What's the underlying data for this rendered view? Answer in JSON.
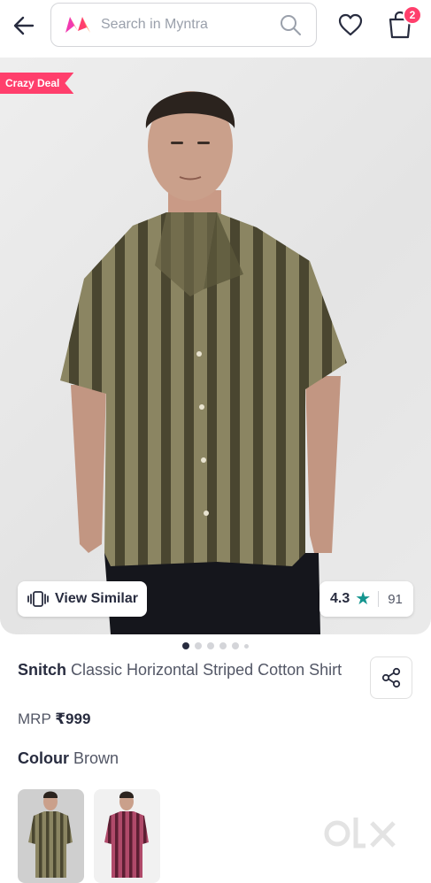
{
  "header": {
    "search_placeholder": "Search in Myntra",
    "bag_count": "2"
  },
  "product": {
    "deal_badge": "Crazy Deal",
    "view_similar_label": "View Similar",
    "rating": "4.3",
    "rating_count": "91",
    "brand": "Snitch",
    "name": "Classic Horizontal Striped Cotton Shirt",
    "mrp_label": "MRP",
    "price": "₹999",
    "colour_label": "Colour",
    "colour_value": "Brown"
  },
  "carousel": {
    "active_index": 0
  },
  "colors": {
    "accent": "#ff3f6c",
    "rating_star": "#14958f",
    "text_primary": "#282c3f",
    "text_secondary": "#535766"
  },
  "watermark": "olx"
}
